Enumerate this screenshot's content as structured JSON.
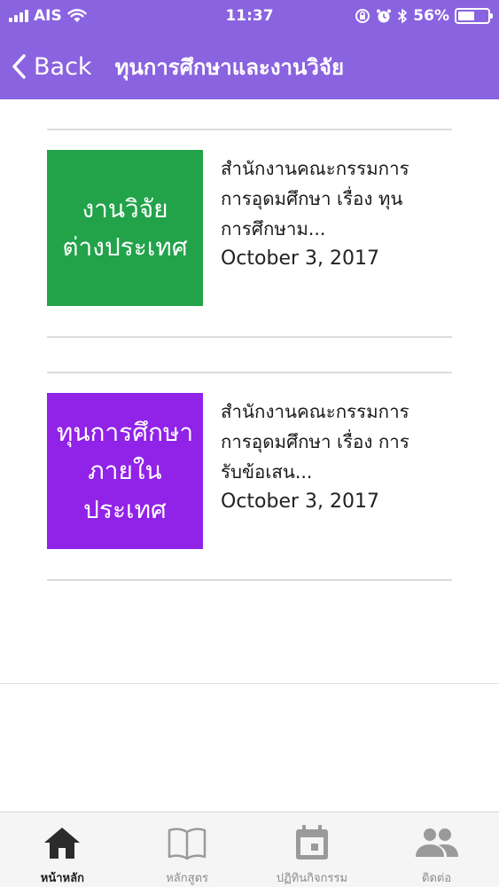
{
  "status_bar": {
    "carrier": "AIS",
    "time": "11:37",
    "battery_percent": "56%",
    "battery_level": 0.56,
    "icons": [
      "signal-icon",
      "wifi-icon",
      "rotation-lock-icon",
      "alarm-icon",
      "bluetooth-icon",
      "battery-icon"
    ]
  },
  "nav": {
    "back_label": "Back",
    "title": "ทุนการศึกษาและงานวิจัย"
  },
  "items": [
    {
      "thumb_line1": "งานวิจัย",
      "thumb_line2": "ต่างประเทศ",
      "thumb_color": "#22a34a",
      "title": "สำนักงานคณะกรรมการ\nการอุดมศึกษา เรื่อง ทุน\nการศึกษาม...",
      "date": "October 3, 2017"
    },
    {
      "thumb_line1": "ทุนการศึกษา",
      "thumb_line2": "ภายในประเทศ",
      "thumb_color": "#9122e8",
      "title": "สำนักงานคณะกรรมการ\nการอุดมศึกษา เรื่อง การ\nรับข้อเสน...",
      "date": "October 3, 2017"
    }
  ],
  "tabbar": {
    "tabs": [
      {
        "label": "หน้าหลัก",
        "icon": "home-icon",
        "active": true
      },
      {
        "label": "หลักสูตร",
        "icon": "book-icon",
        "active": false
      },
      {
        "label": "ปฏิทินกิจกรรม",
        "icon": "calendar-icon",
        "active": false
      },
      {
        "label": "ติดต่อ",
        "icon": "people-icon",
        "active": false
      }
    ]
  },
  "colors": {
    "header_bg": "#8a63e0",
    "tab_active": "#2b2b2b",
    "tab_inactive": "#9a9a9a"
  }
}
